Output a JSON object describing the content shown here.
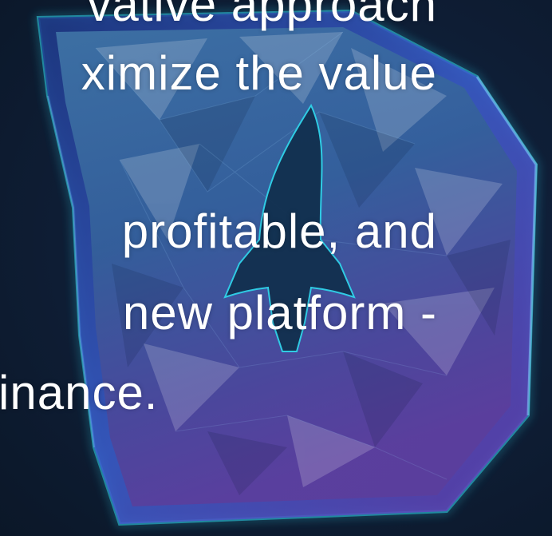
{
  "text_lines": [
    "vative approach",
    "ximize the value",
    "profitable, and",
    "new platform -",
    "inance."
  ],
  "colors": {
    "background": "#0f1f38",
    "text": "#ffffff",
    "logo_glow": "#2fd2e8",
    "logo_top": "#3f74a6",
    "logo_bottom": "#5b3e9c"
  },
  "logo_icon": "rocket-d-logo-icon"
}
